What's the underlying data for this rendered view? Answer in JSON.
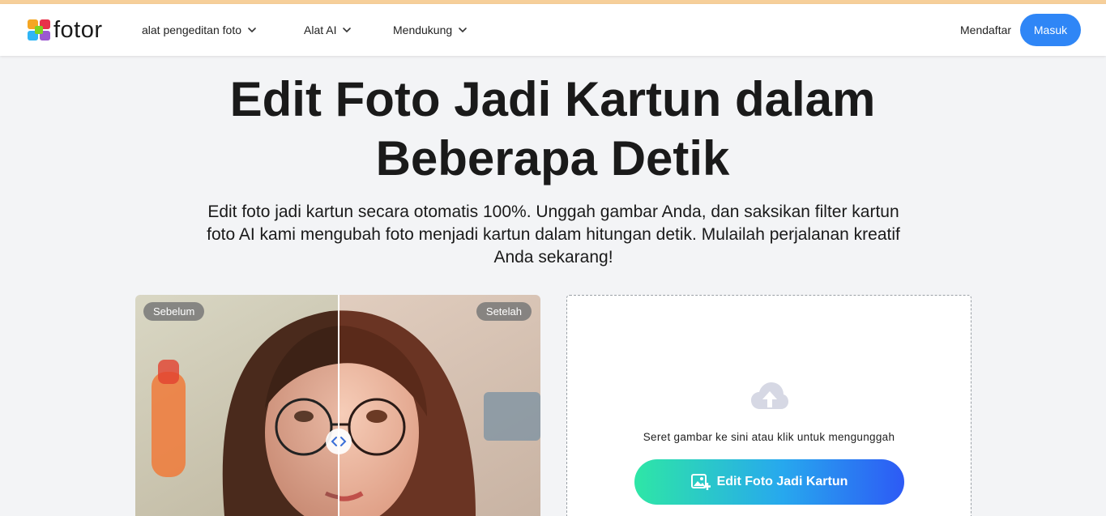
{
  "header": {
    "logo_text": "fotor",
    "nav": [
      {
        "label": "alat pengeditan foto"
      },
      {
        "label": "Alat AI"
      },
      {
        "label": "Mendukung"
      }
    ],
    "signup_label": "Mendaftar",
    "login_label": "Masuk"
  },
  "hero": {
    "title": "Edit Foto Jadi Kartun dalam Beberapa Detik",
    "subtitle": "Edit foto jadi kartun secara otomatis 100%. Unggah gambar Anda, dan saksikan filter kartun foto AI kami mengubah foto menjadi kartun dalam hitungan detik. Mulailah perjalanan kreatif Anda sekarang!"
  },
  "compare": {
    "before_label": "Sebelum",
    "after_label": "Setelah",
    "slider_position": 0.5
  },
  "upload": {
    "hint": "Seret gambar ke sini atau klik untuk mengunggah",
    "button_label": "Edit Foto Jadi Kartun"
  },
  "colors": {
    "accent": "#2f86f6",
    "page_bg": "#f3f4f6",
    "top_strip": "#f6cf9a"
  },
  "icons": [
    "fotor-logo-icon",
    "chevron-down-icon",
    "slider-arrows-icon",
    "cloud-upload-icon",
    "add-image-icon"
  ]
}
